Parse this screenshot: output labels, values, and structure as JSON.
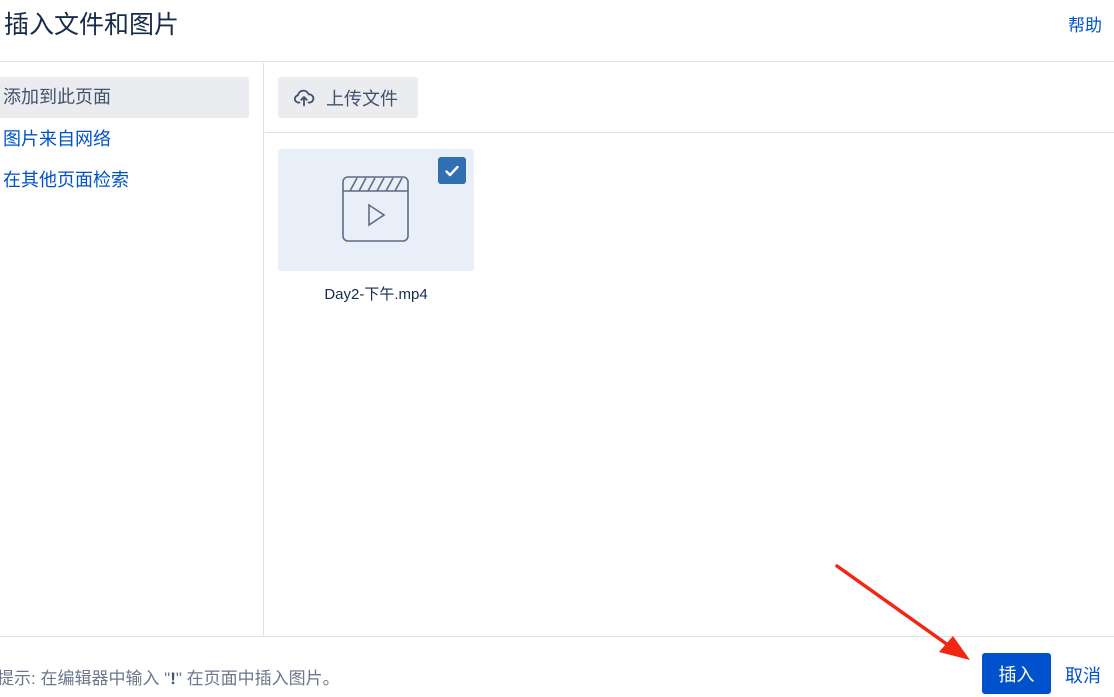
{
  "dialog": {
    "title": "插入文件和图片",
    "help_label": "帮助"
  },
  "sidebar": {
    "items": [
      {
        "label": "添加到此页面",
        "active": true
      },
      {
        "label": "图片来自网络",
        "active": false
      },
      {
        "label": "在其他页面检索",
        "active": false
      }
    ]
  },
  "toolbar": {
    "upload_label": "上传文件",
    "upload_icon": "cloud-upload-icon"
  },
  "files": [
    {
      "name": "Day2-下午.mp4",
      "icon": "video-file-icon",
      "selected": true
    }
  ],
  "footer": {
    "hint_prefix": "提示: 在编辑器中输入 \"",
    "hint_key": "!",
    "hint_suffix": "\" 在页面中插入图片。",
    "insert_label": "插入",
    "cancel_label": "取消"
  },
  "annotation": {
    "arrow_color": "#f22613"
  },
  "colors": {
    "primary": "#0052cc",
    "checkbox": "#2f6fb2",
    "thumb_bg": "#e9eff8",
    "active_nav_bg": "#ebecf0"
  }
}
